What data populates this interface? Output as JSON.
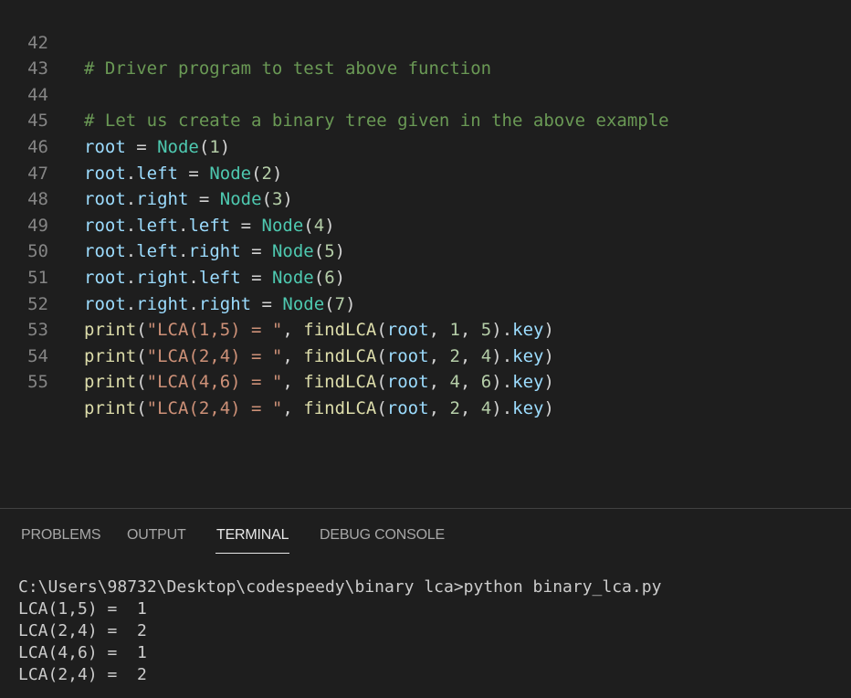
{
  "colors": {
    "background": "#1e1e1e",
    "comment": "#6a9955",
    "variable": "#9cdcfe",
    "class": "#4ec9b0",
    "function": "#dcdcaa",
    "string": "#ce9178",
    "number": "#b5cea8",
    "plain": "#d4d4d4",
    "line_number": "#858585"
  },
  "editor": {
    "lines": [
      {
        "num": "42",
        "tokens": [
          {
            "t": "# Driver program to test above function",
            "c": "comment"
          }
        ]
      },
      {
        "num": "43",
        "tokens": []
      },
      {
        "num": "44",
        "tokens": [
          {
            "t": "# Let us create a binary tree given in the above example",
            "c": "comment"
          }
        ]
      },
      {
        "num": "45",
        "tokens": [
          {
            "t": "root",
            "c": "variable"
          },
          {
            "t": " = ",
            "c": "plain"
          },
          {
            "t": "Node",
            "c": "class"
          },
          {
            "t": "(",
            "c": "plain"
          },
          {
            "t": "1",
            "c": "number"
          },
          {
            "t": ")",
            "c": "plain"
          }
        ]
      },
      {
        "num": "46",
        "tokens": [
          {
            "t": "root",
            "c": "variable"
          },
          {
            "t": ".",
            "c": "plain"
          },
          {
            "t": "left",
            "c": "variable"
          },
          {
            "t": " = ",
            "c": "plain"
          },
          {
            "t": "Node",
            "c": "class"
          },
          {
            "t": "(",
            "c": "plain"
          },
          {
            "t": "2",
            "c": "number"
          },
          {
            "t": ")",
            "c": "plain"
          }
        ]
      },
      {
        "num": "47",
        "tokens": [
          {
            "t": "root",
            "c": "variable"
          },
          {
            "t": ".",
            "c": "plain"
          },
          {
            "t": "right",
            "c": "variable"
          },
          {
            "t": " = ",
            "c": "plain"
          },
          {
            "t": "Node",
            "c": "class"
          },
          {
            "t": "(",
            "c": "plain"
          },
          {
            "t": "3",
            "c": "number"
          },
          {
            "t": ")",
            "c": "plain"
          }
        ]
      },
      {
        "num": "48",
        "tokens": [
          {
            "t": "root",
            "c": "variable"
          },
          {
            "t": ".",
            "c": "plain"
          },
          {
            "t": "left",
            "c": "variable"
          },
          {
            "t": ".",
            "c": "plain"
          },
          {
            "t": "left",
            "c": "variable"
          },
          {
            "t": " = ",
            "c": "plain"
          },
          {
            "t": "Node",
            "c": "class"
          },
          {
            "t": "(",
            "c": "plain"
          },
          {
            "t": "4",
            "c": "number"
          },
          {
            "t": ")",
            "c": "plain"
          }
        ]
      },
      {
        "num": "49",
        "tokens": [
          {
            "t": "root",
            "c": "variable"
          },
          {
            "t": ".",
            "c": "plain"
          },
          {
            "t": "left",
            "c": "variable"
          },
          {
            "t": ".",
            "c": "plain"
          },
          {
            "t": "right",
            "c": "variable"
          },
          {
            "t": " = ",
            "c": "plain"
          },
          {
            "t": "Node",
            "c": "class"
          },
          {
            "t": "(",
            "c": "plain"
          },
          {
            "t": "5",
            "c": "number"
          },
          {
            "t": ")",
            "c": "plain"
          }
        ]
      },
      {
        "num": "50",
        "tokens": [
          {
            "t": "root",
            "c": "variable"
          },
          {
            "t": ".",
            "c": "plain"
          },
          {
            "t": "right",
            "c": "variable"
          },
          {
            "t": ".",
            "c": "plain"
          },
          {
            "t": "left",
            "c": "variable"
          },
          {
            "t": " = ",
            "c": "plain"
          },
          {
            "t": "Node",
            "c": "class"
          },
          {
            "t": "(",
            "c": "plain"
          },
          {
            "t": "6",
            "c": "number"
          },
          {
            "t": ")",
            "c": "plain"
          }
        ]
      },
      {
        "num": "51",
        "tokens": [
          {
            "t": "root",
            "c": "variable"
          },
          {
            "t": ".",
            "c": "plain"
          },
          {
            "t": "right",
            "c": "variable"
          },
          {
            "t": ".",
            "c": "plain"
          },
          {
            "t": "right",
            "c": "variable"
          },
          {
            "t": " = ",
            "c": "plain"
          },
          {
            "t": "Node",
            "c": "class"
          },
          {
            "t": "(",
            "c": "plain"
          },
          {
            "t": "7",
            "c": "number"
          },
          {
            "t": ")",
            "c": "plain"
          }
        ]
      },
      {
        "num": "52",
        "tokens": [
          {
            "t": "print",
            "c": "function"
          },
          {
            "t": "(",
            "c": "plain"
          },
          {
            "t": "\"LCA(1,5) = \"",
            "c": "string"
          },
          {
            "t": ", ",
            "c": "plain"
          },
          {
            "t": "findLCA",
            "c": "function"
          },
          {
            "t": "(",
            "c": "plain"
          },
          {
            "t": "root",
            "c": "variable"
          },
          {
            "t": ", ",
            "c": "plain"
          },
          {
            "t": "1",
            "c": "number"
          },
          {
            "t": ", ",
            "c": "plain"
          },
          {
            "t": "5",
            "c": "number"
          },
          {
            "t": ").",
            "c": "plain"
          },
          {
            "t": "key",
            "c": "variable"
          },
          {
            "t": ")",
            "c": "plain"
          }
        ]
      },
      {
        "num": "53",
        "tokens": [
          {
            "t": "print",
            "c": "function"
          },
          {
            "t": "(",
            "c": "plain"
          },
          {
            "t": "\"LCA(2,4) = \"",
            "c": "string"
          },
          {
            "t": ", ",
            "c": "plain"
          },
          {
            "t": "findLCA",
            "c": "function"
          },
          {
            "t": "(",
            "c": "plain"
          },
          {
            "t": "root",
            "c": "variable"
          },
          {
            "t": ", ",
            "c": "plain"
          },
          {
            "t": "2",
            "c": "number"
          },
          {
            "t": ", ",
            "c": "plain"
          },
          {
            "t": "4",
            "c": "number"
          },
          {
            "t": ").",
            "c": "plain"
          },
          {
            "t": "key",
            "c": "variable"
          },
          {
            "t": ")",
            "c": "plain"
          }
        ]
      },
      {
        "num": "54",
        "tokens": [
          {
            "t": "print",
            "c": "function"
          },
          {
            "t": "(",
            "c": "plain"
          },
          {
            "t": "\"LCA(4,6) = \"",
            "c": "string"
          },
          {
            "t": ", ",
            "c": "plain"
          },
          {
            "t": "findLCA",
            "c": "function"
          },
          {
            "t": "(",
            "c": "plain"
          },
          {
            "t": "root",
            "c": "variable"
          },
          {
            "t": ", ",
            "c": "plain"
          },
          {
            "t": "4",
            "c": "number"
          },
          {
            "t": ", ",
            "c": "plain"
          },
          {
            "t": "6",
            "c": "number"
          },
          {
            "t": ").",
            "c": "plain"
          },
          {
            "t": "key",
            "c": "variable"
          },
          {
            "t": ")",
            "c": "plain"
          }
        ]
      },
      {
        "num": "55",
        "tokens": [
          {
            "t": "print",
            "c": "function"
          },
          {
            "t": "(",
            "c": "plain"
          },
          {
            "t": "\"LCA(2,4) = \"",
            "c": "string"
          },
          {
            "t": ", ",
            "c": "plain"
          },
          {
            "t": "findLCA",
            "c": "function"
          },
          {
            "t": "(",
            "c": "plain"
          },
          {
            "t": "root",
            "c": "variable"
          },
          {
            "t": ", ",
            "c": "plain"
          },
          {
            "t": "2",
            "c": "number"
          },
          {
            "t": ", ",
            "c": "plain"
          },
          {
            "t": "4",
            "c": "number"
          },
          {
            "t": ").",
            "c": "plain"
          },
          {
            "t": "key",
            "c": "variable"
          },
          {
            "t": ")",
            "c": "plain"
          }
        ]
      }
    ]
  },
  "panel": {
    "tabs": [
      {
        "label": "PROBLEMS",
        "active": false
      },
      {
        "label": "OUTPUT",
        "active": false
      },
      {
        "label": "TERMINAL",
        "active": true
      },
      {
        "label": "DEBUG CONSOLE",
        "active": false
      }
    ],
    "terminal": {
      "lines": [
        "C:\\Users\\98732\\Desktop\\codespeedy\\binary lca>python binary_lca.py",
        "LCA(1,5) =  1",
        "LCA(2,4) =  2",
        "LCA(4,6) =  1",
        "LCA(2,4) =  2"
      ]
    }
  }
}
